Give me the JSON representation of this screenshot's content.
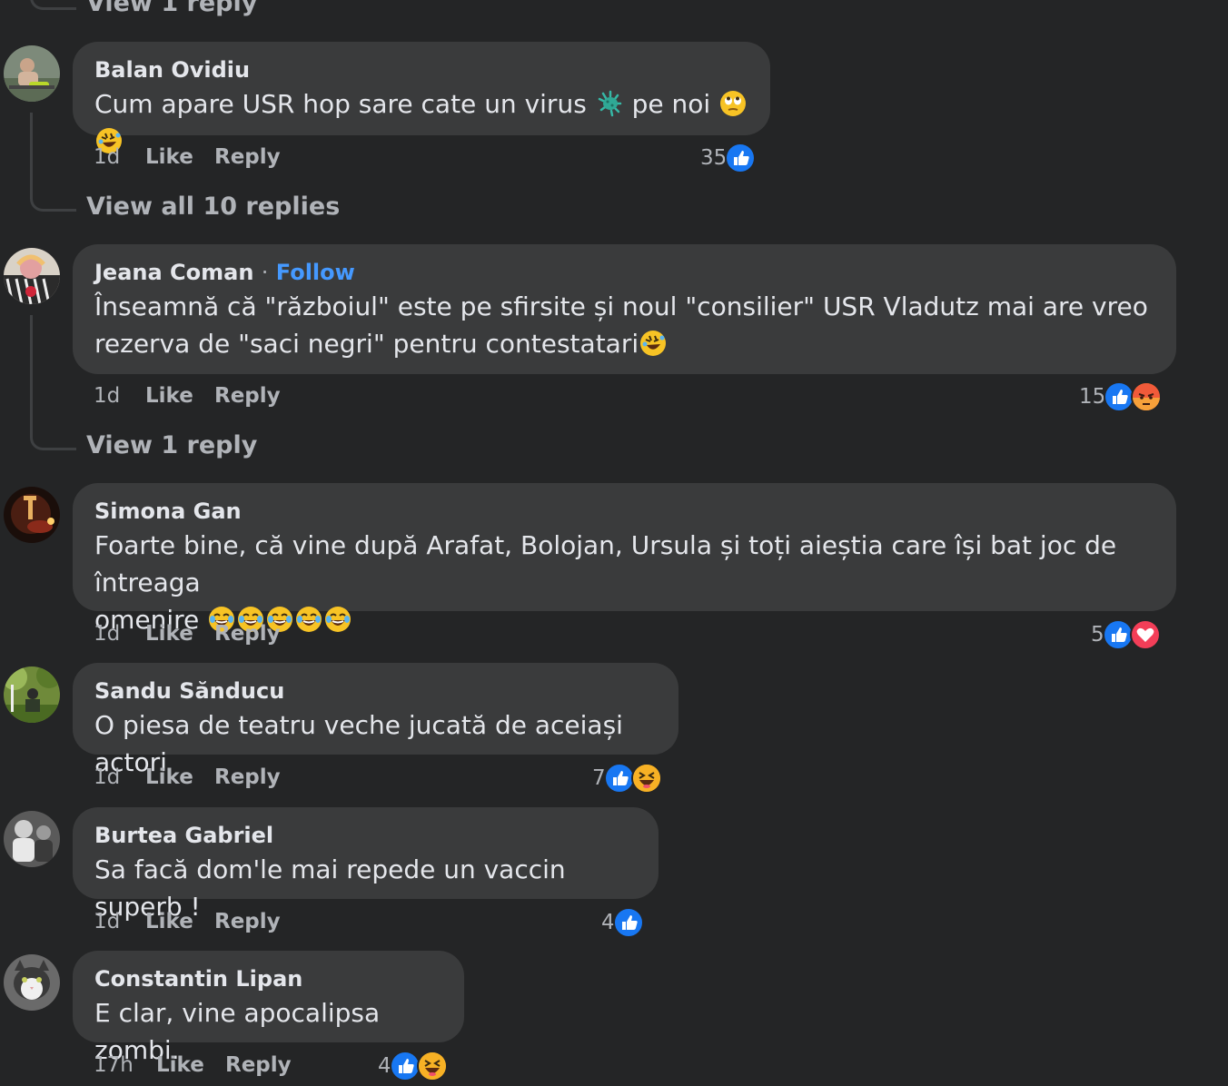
{
  "top_view_replies": "View 1 reply",
  "comments": [
    {
      "author": "Balan Ovidiu",
      "text_before": "Cum apare USR hop sare cate un virus ",
      "text_after": " pe noi ",
      "time": "1d",
      "like": "Like",
      "reply": "Reply",
      "reaction_count": "35",
      "reactions": [
        "like-icon"
      ],
      "view_replies": "View all 10 replies"
    },
    {
      "author": "Jeana Coman",
      "separator": "·",
      "follow": "Follow",
      "line1": "Înseamnă că \"războiul\" este pe sfirsite și noul \"consilier\" USR Vladutz mai are vreo",
      "line2": "rezerva de \"saci negri\" pentru contestatari",
      "time": "1d",
      "like": "Like",
      "reply": "Reply",
      "reaction_count": "15",
      "reactions": [
        "like-icon",
        "angry-icon"
      ],
      "view_replies": "View 1 reply"
    },
    {
      "author": "Simona Gan",
      "line1": "Foarte bine, că vine după Arafat, Bolojan, Ursula și toți aieștia care își bat joc de întreaga",
      "line2": "omenire ",
      "time": "1d",
      "like": "Like",
      "reply": "Reply",
      "reaction_count": "5",
      "reactions": [
        "like-icon",
        "love-icon"
      ]
    },
    {
      "author": "Sandu Sănducu",
      "text": "O piesa de teatru veche jucată de aceiași actori",
      "time": "1d",
      "like": "Like",
      "reply": "Reply",
      "reaction_count": "7",
      "reactions": [
        "like-icon",
        "haha-icon"
      ]
    },
    {
      "author": "Burtea Gabriel",
      "text": "Sa facă dom'le mai repede un vaccin superb !",
      "time": "1d",
      "like": "Like",
      "reply": "Reply",
      "reaction_count": "4",
      "reactions": [
        "like-icon"
      ]
    },
    {
      "author": "Constantin Lipan",
      "text": "E clar, vine apocalipsa zombi.",
      "time": "17h",
      "like": "Like",
      "reply": "Reply",
      "reaction_count": "4",
      "reactions": [
        "like-icon",
        "haha-icon"
      ]
    }
  ],
  "colors": {
    "background": "#242526",
    "bubble": "#3a3b3c",
    "secondary_text": "#b0b3b8",
    "link_blue": "#4599ff",
    "like_blue": "#1877f2",
    "love_red": "#f33e58",
    "angry_orange": "#e9710f",
    "haha_yellow": "#f7b125"
  }
}
